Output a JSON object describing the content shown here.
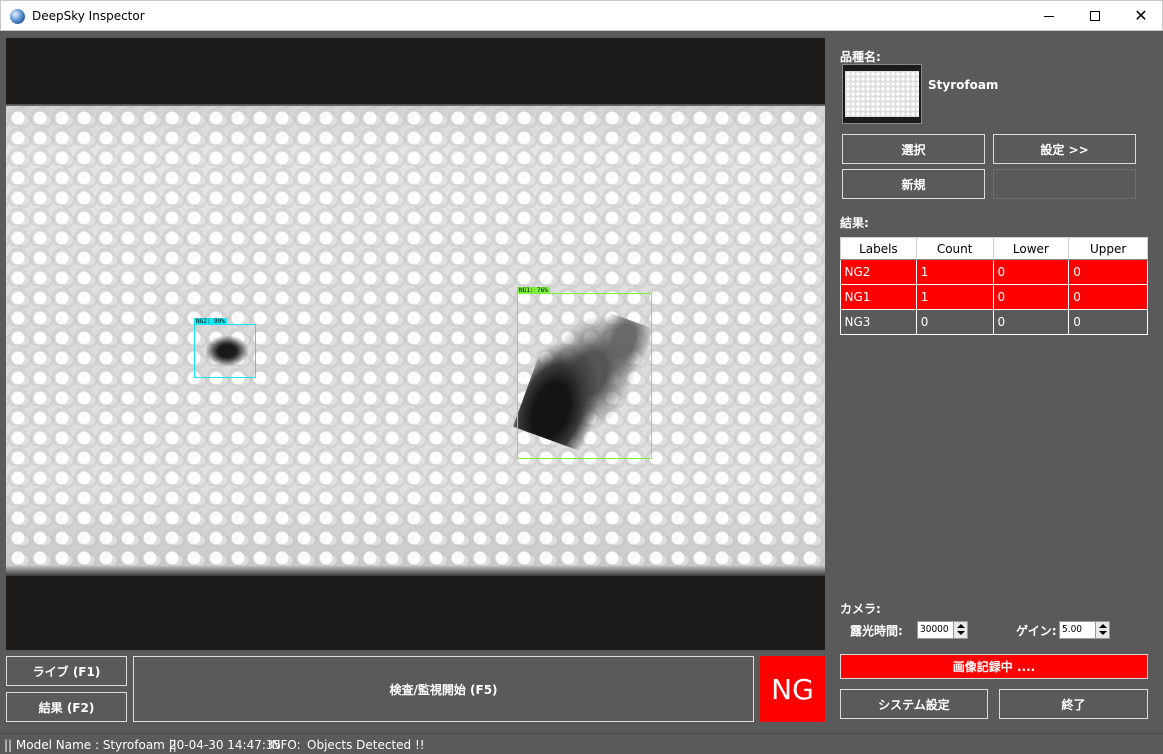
{
  "window": {
    "title": "DeepSky Inspector",
    "controls": {
      "minimize": "minimize-icon",
      "maximize": "maximize-icon",
      "close": "close-icon"
    }
  },
  "viewer": {
    "detections": [
      {
        "label": "NG2: 99%",
        "color": "#19e6f0"
      },
      {
        "label": "NG1: 76%",
        "color": "#7cf03a"
      }
    ]
  },
  "bottom_buttons": {
    "live": "ライブ (F1)",
    "result": "結果 (F2)",
    "inspect": "検査/監視開始 (F5)",
    "verdict": "NG"
  },
  "product": {
    "label": "品種名:",
    "name": "Styrofoam",
    "select_button": "選択",
    "settings_button": "設定 >>",
    "new_button": "新規"
  },
  "results": {
    "label": "結果:",
    "columns": [
      "Labels",
      "Count",
      "Lower",
      "Upper"
    ],
    "rows": [
      {
        "label": "NG2",
        "count": "1",
        "lower": "0",
        "upper": "0",
        "status": "red"
      },
      {
        "label": "NG1",
        "count": "1",
        "lower": "0",
        "upper": "0",
        "status": "red"
      },
      {
        "label": "NG3",
        "count": "0",
        "lower": "0",
        "upper": "0",
        "status": "normal"
      }
    ]
  },
  "camera": {
    "label": "カメラ:",
    "exposure_label": "露光時間:",
    "exposure_value": "30000",
    "gain_label": "ゲイン:",
    "gain_value": "5.00"
  },
  "recording": "画像記録中 ....",
  "system_button": "システム設定",
  "exit_button": "終了",
  "status": {
    "model": "|| Model Name : Styrofoam ||",
    "time": "20-04-30 14:47:35",
    "info": "INFO:",
    "message": "Objects Detected !!"
  },
  "colors": {
    "ng": "#ff0000",
    "background": "#5a5a5a"
  }
}
